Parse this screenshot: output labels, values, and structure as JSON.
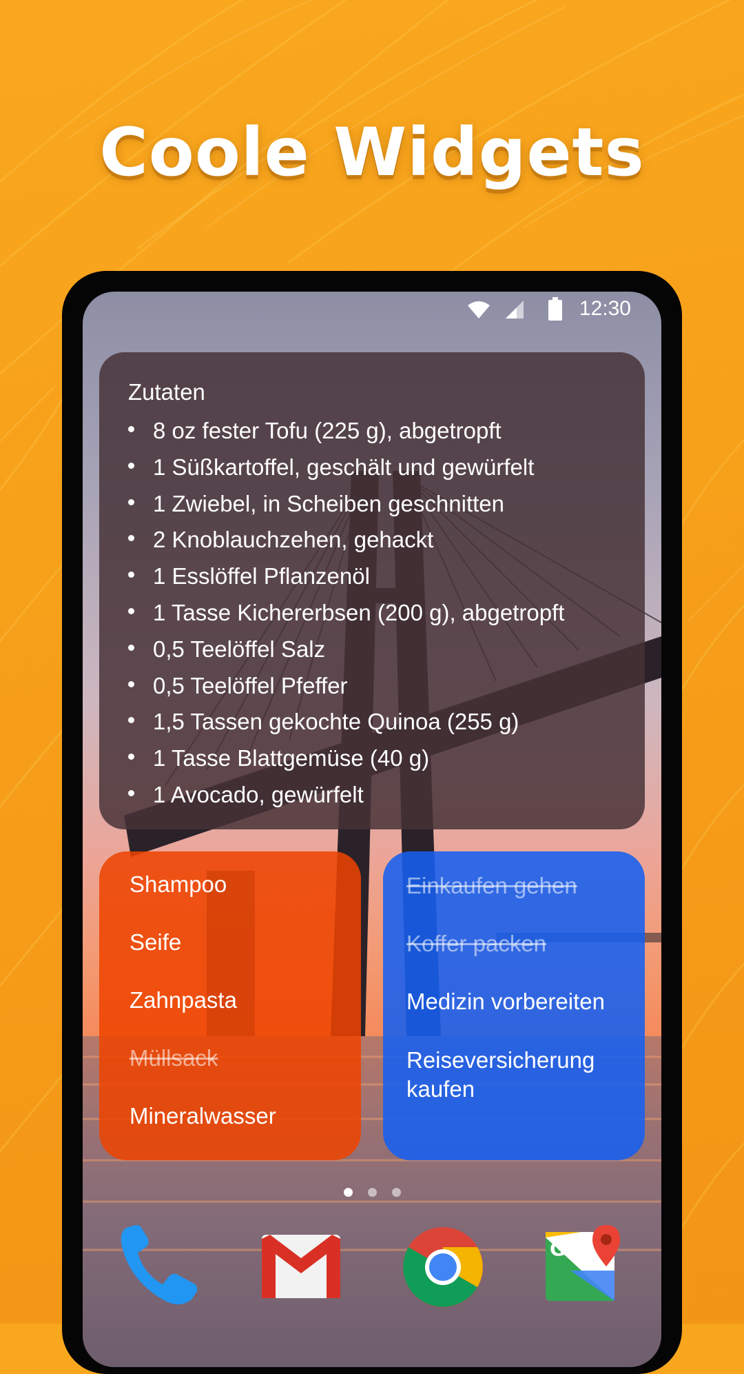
{
  "headline": "Coole Widgets",
  "status_bar": {
    "time": "12:30"
  },
  "ingredients_widget": {
    "title": "Zutaten",
    "items": [
      "8 oz fester Tofu (225 g), abgetropft",
      "1 Süßkartoffel, geschält und gewürfelt",
      "1 Zwiebel, in Scheiben geschnitten",
      "2 Knoblauchzehen, gehackt",
      "1 Esslöffel Pflanzenöl",
      "1 Tasse Kichererbsen (200 g), abgetropft",
      "0,5 Teelöffel Salz",
      "0,5 Teelöffel Pfeffer",
      "1,5 Tassen gekochte Quinoa (255 g)",
      "1 Tasse Blattgemüse (40 g)",
      "1 Avocado, gewürfelt"
    ]
  },
  "shopping_widget": {
    "color": "#ee4400",
    "items": [
      {
        "label": "Shampoo",
        "done": false
      },
      {
        "label": "Seife",
        "done": false
      },
      {
        "label": "Zahnpasta",
        "done": false
      },
      {
        "label": "Müllsack",
        "done": true
      },
      {
        "label": "Mineralwasser",
        "done": false
      }
    ]
  },
  "travel_widget": {
    "color": "#1660f0",
    "items": [
      {
        "label": "Einkaufen gehen",
        "done": true
      },
      {
        "label": "Koffer packen",
        "done": true
      },
      {
        "label": "Medizin vorbereiten",
        "done": false
      },
      {
        "label": "Reiseversicherung kaufen",
        "done": false
      }
    ]
  },
  "page_indicator": {
    "count": 3,
    "active": 1
  },
  "dock": [
    "phone-icon",
    "gmail-icon",
    "chrome-icon",
    "maps-icon"
  ],
  "colors": {
    "background": "#f7a01a",
    "headline": "#ffffff"
  }
}
